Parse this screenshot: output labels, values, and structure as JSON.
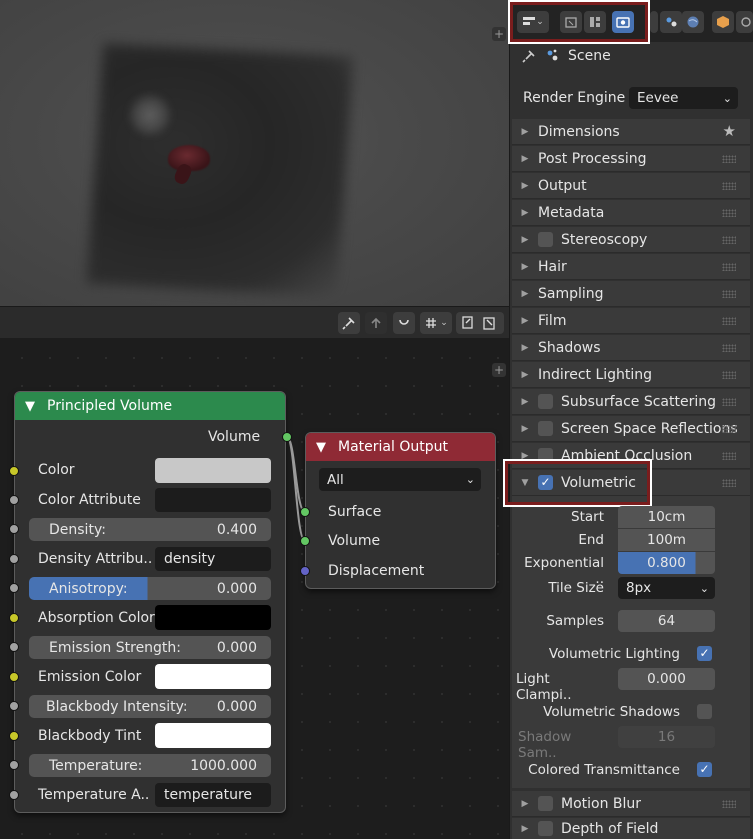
{
  "node_editor": {
    "principled_volume": {
      "title": "Principled Volume",
      "output_volume": "Volume",
      "color_label": "Color",
      "color_swatch": "#c8c8c8",
      "color_attribute_label": "Color Attribute",
      "color_attribute_value": "",
      "density_label": "Density:",
      "density_value": "0.400",
      "density_attribute_label": "Density Attribu..",
      "density_attribute_value": "density",
      "anisotropy_label": "Anisotropy:",
      "anisotropy_value": "0.000",
      "absorption_color_label": "Absorption Color",
      "absorption_swatch": "#000000",
      "emission_strength_label": "Emission Strength:",
      "emission_strength_value": "0.000",
      "emission_color_label": "Emission Color",
      "emission_swatch": "#ffffff",
      "blackbody_intensity_label": "Blackbody Intensity:",
      "blackbody_intensity_value": "0.000",
      "blackbody_tint_label": "Blackbody Tint",
      "blackbody_swatch": "#ffffff",
      "temperature_label": "Temperature:",
      "temperature_value": "1000.000",
      "temperature_attribute_label": "Temperature A..",
      "temperature_attribute_value": "temperature"
    },
    "material_output": {
      "title": "Material Output",
      "target": "All",
      "surface": "Surface",
      "volume": "Volume",
      "displacement": "Displacement"
    }
  },
  "properties": {
    "scene_label": "Scene",
    "render_engine_label": "Render Engine",
    "render_engine_value": "Eevee",
    "panels": [
      {
        "label": "Dimensions"
      },
      {
        "label": "Post Processing"
      },
      {
        "label": "Output"
      },
      {
        "label": "Metadata"
      },
      {
        "label": "Stereoscopy"
      },
      {
        "label": "Hair"
      },
      {
        "label": "Sampling"
      },
      {
        "label": "Film"
      },
      {
        "label": "Shadows"
      },
      {
        "label": "Indirect Lighting"
      },
      {
        "label": "Subsurface Scattering"
      },
      {
        "label": "Screen Space Reflections"
      },
      {
        "label": "Ambient Occlusion"
      }
    ],
    "volumetric": {
      "label": "Volumetric",
      "start_label": "Start",
      "start_value": "10cm",
      "end_label": "End",
      "end_value": "100m",
      "exponential_label": "Exponential ..",
      "exponential_value": "0.800",
      "exponential_fraction": 0.8,
      "tile_size_label": "Tile Size",
      "tile_size_value": "8px",
      "samples_label": "Samples",
      "samples_value": "64",
      "volumetric_lighting_label": "Volumetric Lighting",
      "light_clamp_label": "Light Clampi..",
      "light_clamp_value": "0.000",
      "volumetric_shadows_label": "Volumetric Shadows",
      "shadow_samples_label": "Shadow Sam..",
      "shadow_samples_value": "16",
      "colored_transmittance_label": "Colored Transmittance"
    },
    "bottom_panels": [
      {
        "label": "Motion Blur"
      },
      {
        "label": "Depth of Field"
      }
    ]
  }
}
